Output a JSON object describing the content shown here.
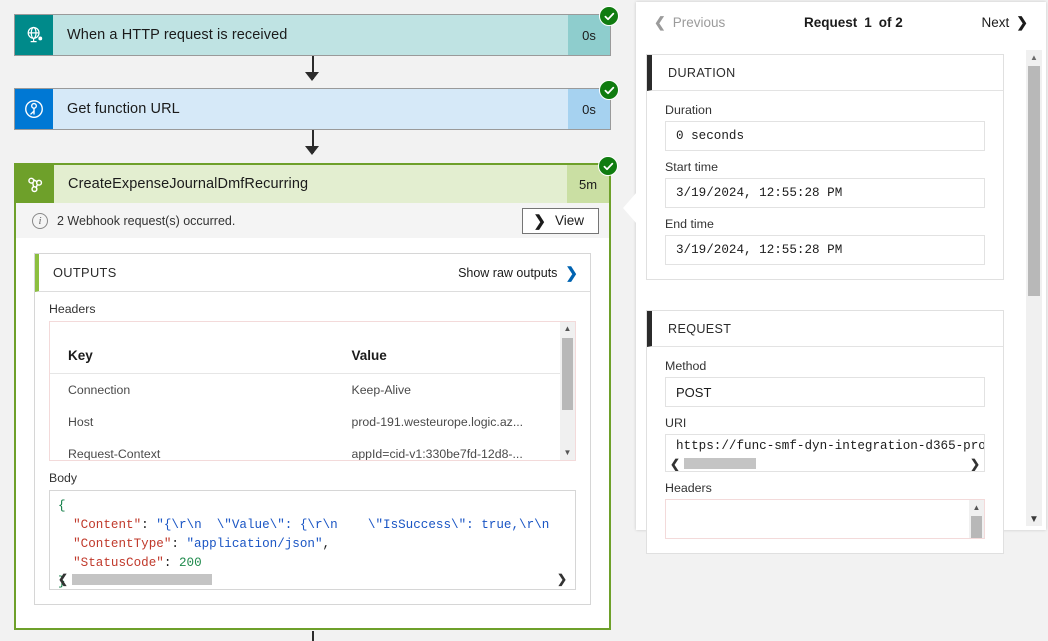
{
  "designer": {
    "cards": [
      {
        "title": "When a HTTP request is received",
        "duration": "0s",
        "icon": "http-request-icon",
        "status": "success"
      },
      {
        "title": "Get function URL",
        "duration": "0s",
        "icon": "azure-function-icon",
        "status": "success"
      },
      {
        "title": "CreateExpenseJournalDmfRecurring",
        "duration": "5m",
        "icon": "webhook-icon",
        "status": "success"
      }
    ],
    "notice": {
      "icon": "info-icon",
      "text": "2 Webhook request(s) occurred.",
      "view_button": "View",
      "view_chevron": "chevron-right-icon"
    },
    "outputs": {
      "title": "OUTPUTS",
      "raw_link": "Show raw outputs",
      "raw_chevron": "chevron-right-icon",
      "headers_label": "Headers",
      "table": {
        "columns": [
          "Key",
          "Value"
        ],
        "rows": [
          [
            "Connection",
            "Keep-Alive"
          ],
          [
            "Host",
            "prod-191.westeurope.logic.az..."
          ],
          [
            "Request-Context",
            "appId=cid-v1:330be7fd-12d8-..."
          ]
        ]
      },
      "body_label": "Body",
      "body_code": [
        {
          "text": "{",
          "cls": "k-brace"
        },
        [
          {
            "text": "  "
          },
          {
            "text": "\"Content\"",
            "cls": "k-key"
          },
          {
            "text": ": "
          },
          {
            "text": "\"{\\r\\n  \\\"Value\\\": {\\r\\n    \\\"IsSuccess\\\": true,\\r\\n",
            "cls": "k-str"
          }
        ],
        [
          {
            "text": "  "
          },
          {
            "text": "\"ContentType\"",
            "cls": "k-key"
          },
          {
            "text": ": "
          },
          {
            "text": "\"application/json\"",
            "cls": "k-str"
          },
          {
            "text": ","
          }
        ],
        [
          {
            "text": "  "
          },
          {
            "text": "\"StatusCode\"",
            "cls": "k-key"
          },
          {
            "text": ": "
          },
          {
            "text": "200",
            "cls": "k-num"
          }
        ],
        {
          "text": "}",
          "cls": "k-brace"
        }
      ]
    }
  },
  "panel": {
    "nav": {
      "previous": "Previous",
      "prev_chevron": "chevron-left-icon",
      "label": "Request",
      "index": "1",
      "of": "of 2",
      "next": "Next",
      "next_chevron": "chevron-right-icon"
    },
    "duration_section": {
      "title": "DURATION",
      "fields": [
        {
          "label": "Duration",
          "value": "0 seconds"
        },
        {
          "label": "Start time",
          "value": "3/19/2024, 12:55:28 PM"
        },
        {
          "label": "End time",
          "value": "3/19/2024, 12:55:28 PM"
        }
      ]
    },
    "request_section": {
      "title": "REQUEST",
      "method_label": "Method",
      "method_value": "POST",
      "uri_label": "URI",
      "uri_value": "https://func-smf-dyn-integration-d365-pro",
      "headers_label": "Headers"
    }
  },
  "colors": {
    "teal": "#008a8a",
    "blue": "#0078d4",
    "green": "#6ea02a",
    "success": "#107c10",
    "link": "#0063b1"
  }
}
